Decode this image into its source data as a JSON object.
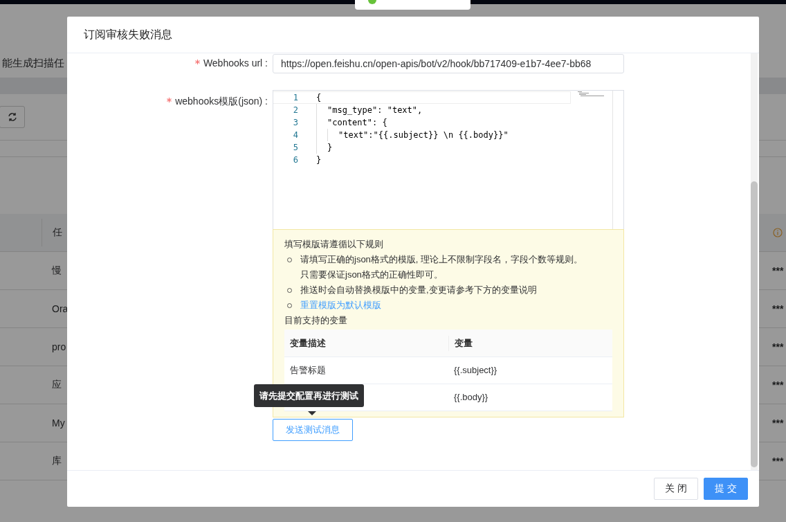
{
  "background": {
    "notice": "能生成扫描任",
    "table_header": "任",
    "rows": [
      {
        "name": "慢",
        "masked": "***"
      },
      {
        "name": "Ora",
        "masked": "***"
      },
      {
        "name": "pro",
        "masked": "***"
      },
      {
        "name": "应",
        "masked": "***"
      },
      {
        "name": "My",
        "masked": "***"
      },
      {
        "name": "库",
        "masked": "***"
      }
    ]
  },
  "dialog": {
    "title": "订阅审核失败消息",
    "url_field": {
      "label": "Webhooks url :",
      "required": true,
      "value": "https://open.feishu.cn/open-apis/bot/v2/hook/bb717409-e1b7-4ee7-bb68"
    },
    "template_field": {
      "label": "webhooks模版(json) :",
      "required": true,
      "lines": [
        {
          "number": "1",
          "code": "{"
        },
        {
          "number": "2",
          "code": "  \"msg_type\": \"text\","
        },
        {
          "number": "3",
          "code": "  \"content\": {"
        },
        {
          "number": "4",
          "code": "    \"text\":\"{{.subject}} \\n {{.body}}\""
        },
        {
          "number": "5",
          "code": "  }"
        },
        {
          "number": "6",
          "code": "}"
        }
      ]
    },
    "tips": {
      "title": "填写模版请遵循以下规则",
      "items": [
        {
          "kind": "text",
          "lines": [
            "请填写正确的json格式的模版, 理论上不限制字段名，字段个数等规则。",
            "只需要保证json格式的正确性即可。"
          ]
        },
        {
          "kind": "text",
          "lines": [
            "推送时会自动替换模版中的变量,变更请参考下方的变量说明"
          ]
        },
        {
          "kind": "link",
          "lines": [
            "重置模版为默认模版"
          ]
        }
      ],
      "variables_title": "目前支持的变量",
      "columns": [
        "变量描述",
        "变量"
      ],
      "rows": [
        {
          "description": "告警标题",
          "variable": "{{.subject}}"
        },
        {
          "variable": "{{.body}}"
        }
      ]
    },
    "test_button": "发送测试消息",
    "tooltip": "请先提交配置再进行测试",
    "buttons": [
      {
        "label": "关 闭",
        "kind": "default"
      },
      {
        "label": "提 交",
        "kind": "primary"
      }
    ]
  }
}
